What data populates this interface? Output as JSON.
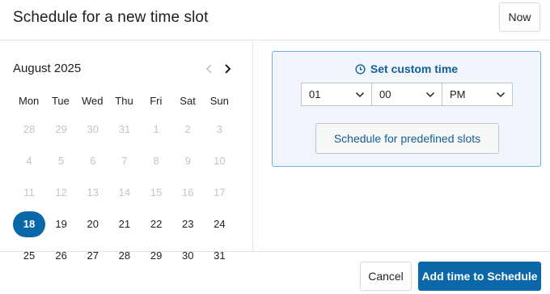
{
  "dialog": {
    "title": "Schedule for a new time slot",
    "now_label": "Now"
  },
  "calendar": {
    "month_label": "August 2025",
    "weekdays": [
      "Mon",
      "Tue",
      "Wed",
      "Thu",
      "Fri",
      "Sat",
      "Sun"
    ],
    "days": [
      {
        "label": "28",
        "state": "disabled"
      },
      {
        "label": "29",
        "state": "disabled"
      },
      {
        "label": "30",
        "state": "disabled"
      },
      {
        "label": "31",
        "state": "disabled"
      },
      {
        "label": "1",
        "state": "disabled"
      },
      {
        "label": "2",
        "state": "disabled"
      },
      {
        "label": "3",
        "state": "disabled"
      },
      {
        "label": "4",
        "state": "disabled"
      },
      {
        "label": "5",
        "state": "disabled"
      },
      {
        "label": "6",
        "state": "disabled"
      },
      {
        "label": "7",
        "state": "disabled"
      },
      {
        "label": "8",
        "state": "disabled"
      },
      {
        "label": "9",
        "state": "disabled"
      },
      {
        "label": "10",
        "state": "disabled"
      },
      {
        "label": "11",
        "state": "disabled"
      },
      {
        "label": "12",
        "state": "disabled"
      },
      {
        "label": "13",
        "state": "disabled"
      },
      {
        "label": "14",
        "state": "disabled"
      },
      {
        "label": "15",
        "state": "disabled"
      },
      {
        "label": "16",
        "state": "disabled"
      },
      {
        "label": "17",
        "state": "disabled"
      },
      {
        "label": "18",
        "state": "selected"
      },
      {
        "label": "19",
        "state": "enabled"
      },
      {
        "label": "20",
        "state": "enabled"
      },
      {
        "label": "21",
        "state": "enabled"
      },
      {
        "label": "22",
        "state": "enabled"
      },
      {
        "label": "23",
        "state": "enabled"
      },
      {
        "label": "24",
        "state": "enabled"
      },
      {
        "label": "25",
        "state": "enabled"
      },
      {
        "label": "26",
        "state": "enabled"
      },
      {
        "label": "27",
        "state": "enabled"
      },
      {
        "label": "28",
        "state": "enabled"
      },
      {
        "label": "29",
        "state": "enabled"
      },
      {
        "label": "30",
        "state": "enabled"
      },
      {
        "label": "31",
        "state": "enabled"
      }
    ],
    "prev_icon": "chevron-left-icon",
    "next_icon": "chevron-right-icon"
  },
  "time": {
    "heading": "Set custom time",
    "heading_icon": "clock-icon",
    "hour": "01",
    "minute": "00",
    "meridiem": "PM",
    "predefined_label": "Schedule for predefined slots"
  },
  "footer": {
    "cancel_label": "Cancel",
    "add_label": "Add time to Schedule"
  },
  "colors": {
    "accent": "#0a68a8",
    "link": "#135e96",
    "panel_bg": "#f0f6fc",
    "panel_border": "#72aee6",
    "disabled_text": "#c3c4c7"
  }
}
